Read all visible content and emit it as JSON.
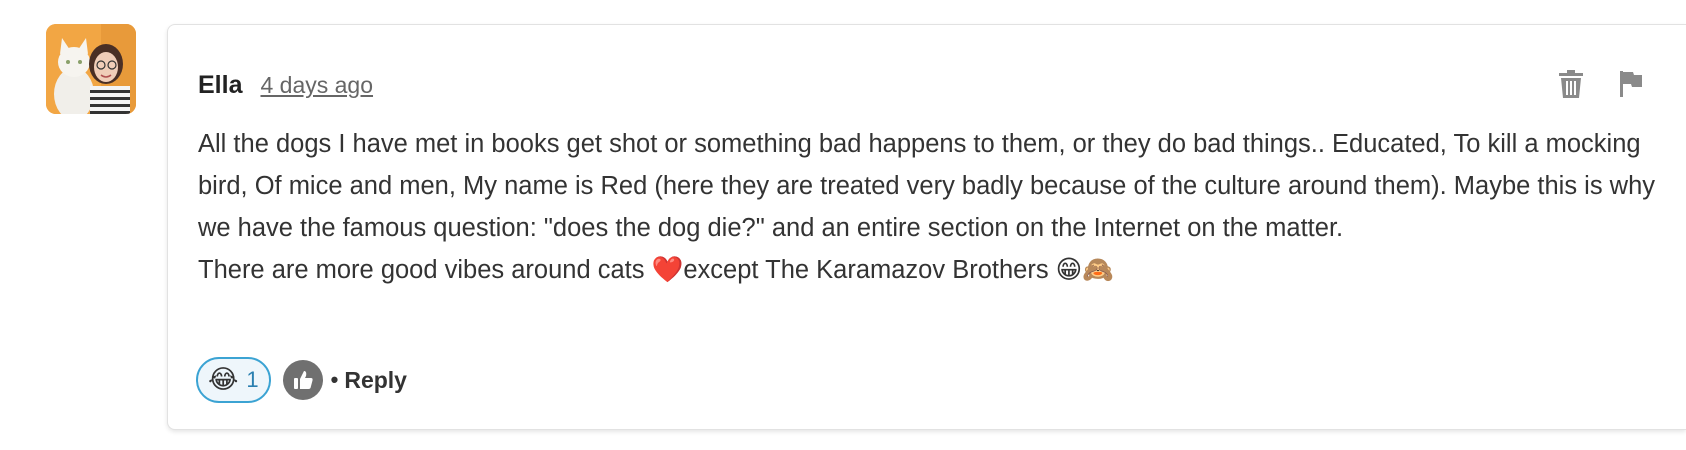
{
  "comment": {
    "author": "Ella",
    "timestamp": "4 days ago",
    "paragraph_1": "All the dogs I have met in books get shot or something bad happens to them, or they do bad things.. Educated, To kill a mocking bird, Of mice and men, My name is Red (here they are treated very badly because of the culture around them). Maybe this is why we have the famous question: \"does the dog die?\"  and an entire section on the Internet on the matter.",
    "paragraph_2_start": "There are more good vibes around cats ",
    "paragraph_2_emoji_heart": "❤️",
    "paragraph_2_end": "except The Karamazov Brothers ",
    "paragraph_2_emoji_grin": "😁",
    "paragraph_2_emoji_monkey": "🙈"
  },
  "actions": {
    "delete_icon": "trash-icon",
    "flag_icon": "flag-icon"
  },
  "footer": {
    "reaction_emoji": "😂",
    "reaction_count": "1",
    "like_icon": "thumbs-up-icon",
    "separator": "•",
    "reply_label": "Reply"
  },
  "colors": {
    "reaction_border": "#3ba3d3",
    "reaction_count": "#2a7fb0",
    "like_bg": "#707070",
    "heart": "#e0202a"
  }
}
